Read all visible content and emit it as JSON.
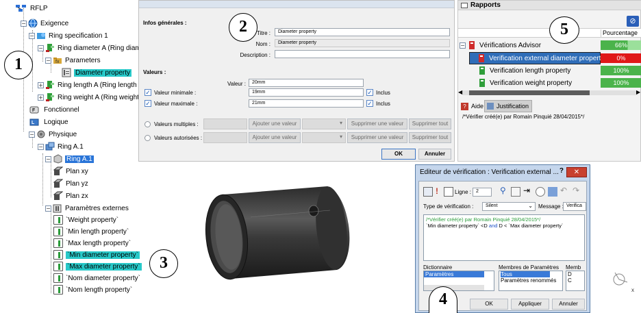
{
  "tree": {
    "root": "RFLP",
    "exigence": "Exigence",
    "ring_spec": "Ring specification 1",
    "ring_diam": "Ring diameter A (Ring diame",
    "parameters": "Parameters",
    "diam_prop": "Diameter property",
    "ring_length": "Ring length A (Ring length A",
    "ring_weight": "Ring weight A (Ring weight A",
    "fonctionnel": "Fonctionnel",
    "logique": "Logique",
    "physique": "Physique",
    "ring_a1": "Ring A.1",
    "ring_a1_sel": "Ring A.1",
    "plan_xy": "Plan xy",
    "plan_yz": "Plan yz",
    "plan_zx": "Plan zx",
    "params_ext": "Paramètres externes",
    "p_weight": "`Weight property`",
    "p_minlen": "`Min length property`",
    "p_maxlen": "`Max length property`",
    "p_mindiam": "`Min diameter property`",
    "p_maxdiam": "`Max diameter property`",
    "p_nomdiam": "`Nom diameter property`",
    "p_nomlen": "`Nom length property`"
  },
  "dialog2": {
    "section_general": "Infos générales :",
    "titre_label": "Titre :",
    "titre_value": "Diameter property",
    "nom_label": "Nom :",
    "nom_value": "Diameter property",
    "desc_label": "Description :",
    "section_valeurs": "Valeurs :",
    "valeur_label": "Valeur :",
    "valeur_value": "20mm",
    "vmin_label": "Valeur minimale :",
    "vmin_value": "19mm",
    "vmax_label": "Valeur maximale :",
    "vmax_value": "21mm",
    "inclus1": "Inclus",
    "inclus2": "Inclus",
    "multiples_label": "Valeurs multiples :",
    "autorisees_label": "Valeurs autorisées :",
    "ajouter1": "Ajouter une valeur",
    "supprimer1": "Supprimer une valeur",
    "supprimer_tout1": "Supprimer tout",
    "ajouter2": "Ajouter une valeur",
    "supprimer2": "Supprimer une valeur",
    "supprimer_tout2": "Supprimer tout",
    "ok": "OK",
    "annuler": "Annuler"
  },
  "rapports": {
    "title": "Rapports",
    "col_pct": "Pourcentage",
    "advisor": "Vérifications Advisor",
    "advisor_pct": "66%",
    "ext_diam": "Verification external diameter property",
    "ext_diam_pct": "0%",
    "length": "Verification length property",
    "length_pct": "100%",
    "weight": "Verification weight property",
    "weight_pct": "100%",
    "aide": "Aide",
    "justification": "Justification",
    "comment": "/*Vérifier créé(e) par Romain Pinquié 28/04/2015*/",
    "colors": {
      "green": "#4bb34b",
      "red": "#e01818"
    }
  },
  "dialog4": {
    "title": "Editeur de vérification : Verification external ...",
    "help": "?",
    "close": "✕",
    "ligne_label": "Ligne :",
    "ligne_value": "2",
    "type_label": "Type de vérification :",
    "type_value": "Silent",
    "message_label": "Message :",
    "message_value": "Verifica",
    "code_line1": "/*Vérifier créé(e) par Romain Pinquié 28/04/2015*/",
    "code_line2_a": "`Min diameter property` <D ",
    "code_line2_and": "and",
    "code_line2_b": " D < `Max diameter property`",
    "dict_label": "Dictionnaire",
    "dict_item": "Paramètres",
    "membres_label": "Membres de Paramètres",
    "membres_item1": "Tous",
    "membres_item2": "Paramètres renommés",
    "memb_label": "Memb",
    "memb_item1": "D",
    "memb_item2": "C",
    "ok": "OK",
    "appliquer": "Appliquer",
    "annuler": "Annuler"
  },
  "callouts": {
    "c1": "1",
    "c2": "2",
    "c3": "3",
    "c4": "4",
    "c5": "5"
  }
}
